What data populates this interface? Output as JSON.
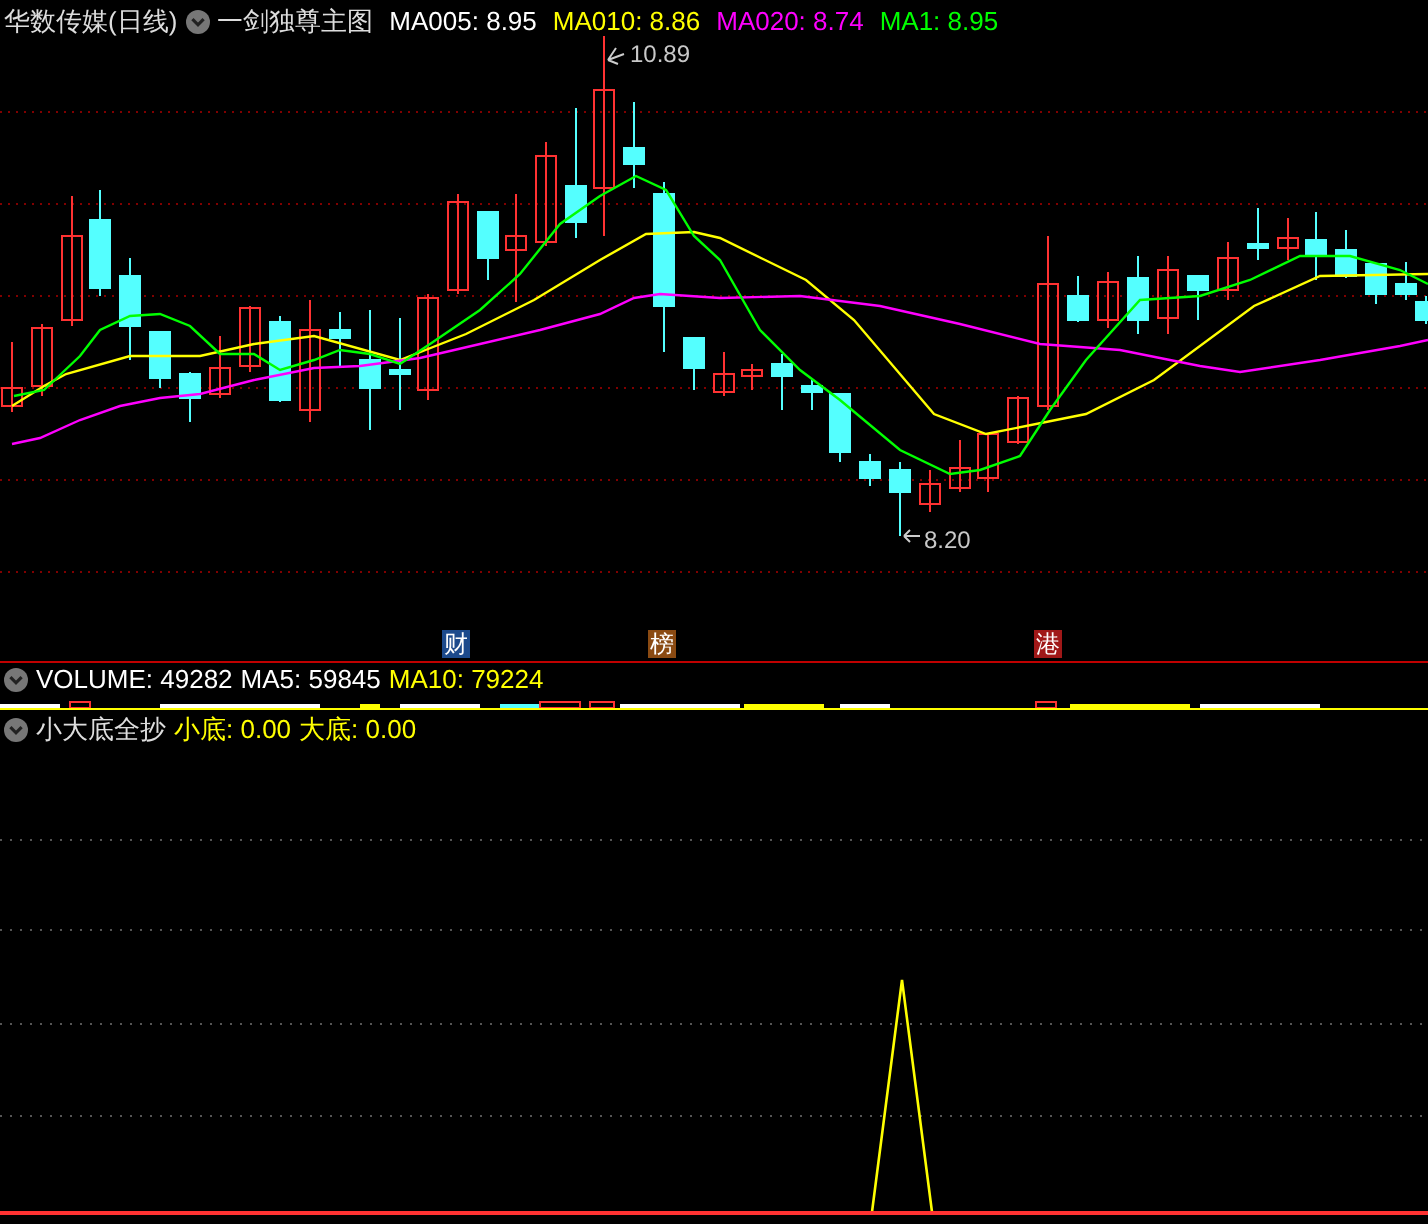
{
  "main_panel": {
    "title": "华数传媒(日线)",
    "indicator": "一剑独尊主图",
    "averages": [
      {
        "text": "MA005: 8.95",
        "color": "#ffffff"
      },
      {
        "text": "MA010: 8.86",
        "color": "#ffff00"
      },
      {
        "text": "MA020: 8.74",
        "color": "#ff00ff"
      },
      {
        "text": "MA1: 8.95",
        "color": "#00ff00"
      }
    ],
    "high_label": "10.89",
    "low_label": "8.20",
    "event_tags": [
      {
        "text": "财",
        "color": "#1c4a8c"
      },
      {
        "text": "榜",
        "color": "#8a4a12"
      },
      {
        "text": "港",
        "color": "#a01818"
      }
    ]
  },
  "volume_panel": {
    "items": [
      {
        "text": "VOLUME: 49282",
        "color": "#ffffff"
      },
      {
        "text": "MA5: 59845",
        "color": "#ffffff"
      },
      {
        "text": "MA10: 79224",
        "color": "#ffff00"
      }
    ]
  },
  "indicator_panel": {
    "name": "小大底全抄",
    "items": [
      {
        "text": "小底: 0.00",
        "color": "#ffff00"
      },
      {
        "text": "大底: 0.00",
        "color": "#ffff00"
      }
    ]
  }
}
